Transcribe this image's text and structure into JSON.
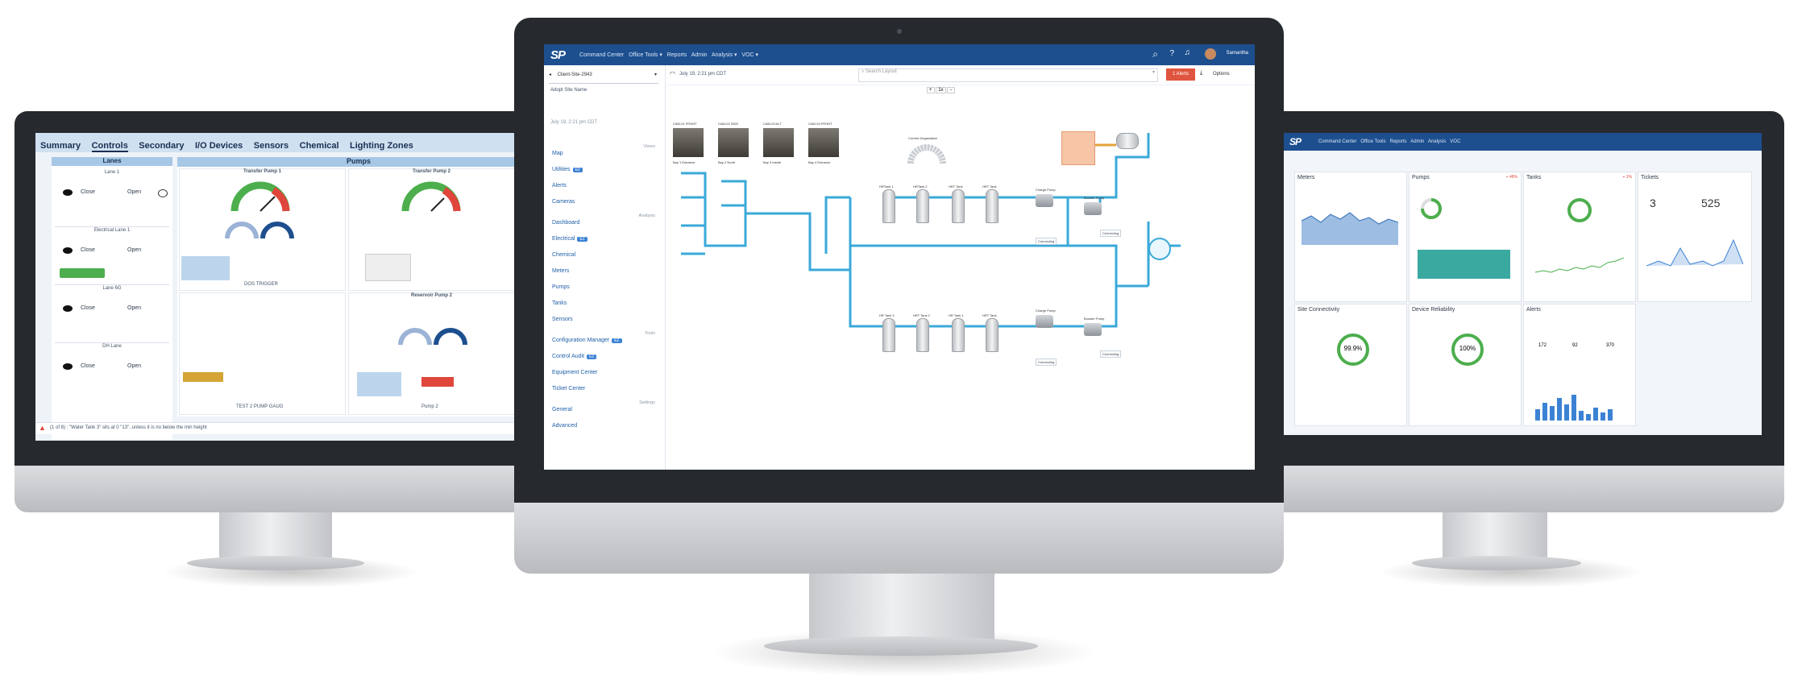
{
  "colors": {
    "accent": "#1d4f8f",
    "pipe": "#3aa9d8",
    "alert": "#e0463b",
    "good": "#4cae4c"
  },
  "left_screen": {
    "tabs": [
      "Summary",
      "Controls",
      "Secondary",
      "I/O Devices",
      "Sensors",
      "Chemical",
      "Lighting Zones"
    ],
    "lanes_title": "Lanes",
    "pumps_title": "Pumps",
    "lane_rows": [
      "Lane 1",
      "Electrical Lane 1",
      "Lane 6G",
      "DH Lane"
    ],
    "gate_labels": {
      "close": "Close",
      "open": "Open"
    },
    "transfer_pump_1": "Transfer Pump 1",
    "transfer_pump_2": "Transfer Pump 2",
    "reservoir_pump": "Reservoir Pump 2",
    "pump2": "Pump 2",
    "dose_trigger": "DOS TRIGGER",
    "test_pump": "TEST 2 PUMP GAUG",
    "status_bar": "(1 of 8) : \"Water Tank 3\" sits at 0 \"13\", unless it is no below the min height"
  },
  "center_screen": {
    "brand": "SP",
    "nav": [
      "Command Center",
      "Office Tools",
      "Reports",
      "Admin",
      "Analysis",
      "VOC"
    ],
    "user": "Samantha",
    "site_select": "Client-Site-2943",
    "site_sub": "Adopt Site Name",
    "date": "July 19, 2:21 pm CDT",
    "search_placeholder": "Search Layout",
    "alerts_btn": "1 Alerts",
    "options_btn": "Options",
    "sidebar_groups": [
      {
        "label": "Map",
        "section": "Views"
      },
      {
        "label": "Utilities",
        "badge": "EZ"
      },
      {
        "label": "Alerts"
      },
      {
        "label": "Cameras"
      },
      {
        "label": "Dashboard",
        "section": "Analysis"
      },
      {
        "label": "Electrical",
        "badge": "EZ"
      },
      {
        "label": "Chemical"
      },
      {
        "label": "Meters"
      },
      {
        "label": "Pumps"
      },
      {
        "label": "Tanks"
      },
      {
        "label": "Sensors"
      },
      {
        "label": "Configuration Manager",
        "badge": "EZ",
        "section": "Tools"
      },
      {
        "label": "Control Audit",
        "badge": "EZ"
      },
      {
        "label": "Equipment Center"
      },
      {
        "label": "Ticket Center"
      },
      {
        "label": "General",
        "section": "Settings"
      },
      {
        "label": "Advanced"
      }
    ],
    "cameras": [
      {
        "name": "CAM-01 FRONT",
        "caption": "Bay 1 Entrance"
      },
      {
        "name": "CAM-02 SIDE",
        "caption": "Bay 2 North"
      },
      {
        "name": "CAM-03 ALT",
        "caption": "Bay 3 Inside"
      },
      {
        "name": "CAM-04 FRONT",
        "caption": "Bay 4 Entrance"
      }
    ],
    "gauge_label": "Current Degradation",
    "tank_labels": [
      "HRTank 1",
      "HRTank 2",
      "HRT Tank",
      "HRT Tank",
      "HR Tank 3",
      "HRT Tank 2",
      "HR Tank 1",
      "HRT Tank"
    ],
    "pump_labels": [
      "Charge Pump",
      "Charge Pump",
      "Booster Pump",
      "Booster Pump"
    ],
    "status_labels": [
      "Connecting",
      "Connecting",
      "Connecting",
      "Connecting"
    ],
    "zoom_label": "1x"
  },
  "right_screen": {
    "nav": [
      "Command Center",
      "Office Tools",
      "Reports",
      "Admin",
      "Analysis",
      "VOC"
    ],
    "cards": [
      {
        "title": "Meters"
      },
      {
        "title": "Pumps",
        "badge": "+ 46%"
      },
      {
        "title": "Tanks",
        "badge": "+ 1%"
      },
      {
        "title": "Tickets"
      }
    ],
    "tickets": {
      "open": "3",
      "avg": "525"
    },
    "bottom_cards": [
      {
        "title": "Site Connectivity",
        "value": "99.9%"
      },
      {
        "title": "Device Reliability",
        "value": "100%"
      },
      {
        "title": "Alerts",
        "values": [
          "172",
          "92",
          "370"
        ]
      }
    ]
  }
}
